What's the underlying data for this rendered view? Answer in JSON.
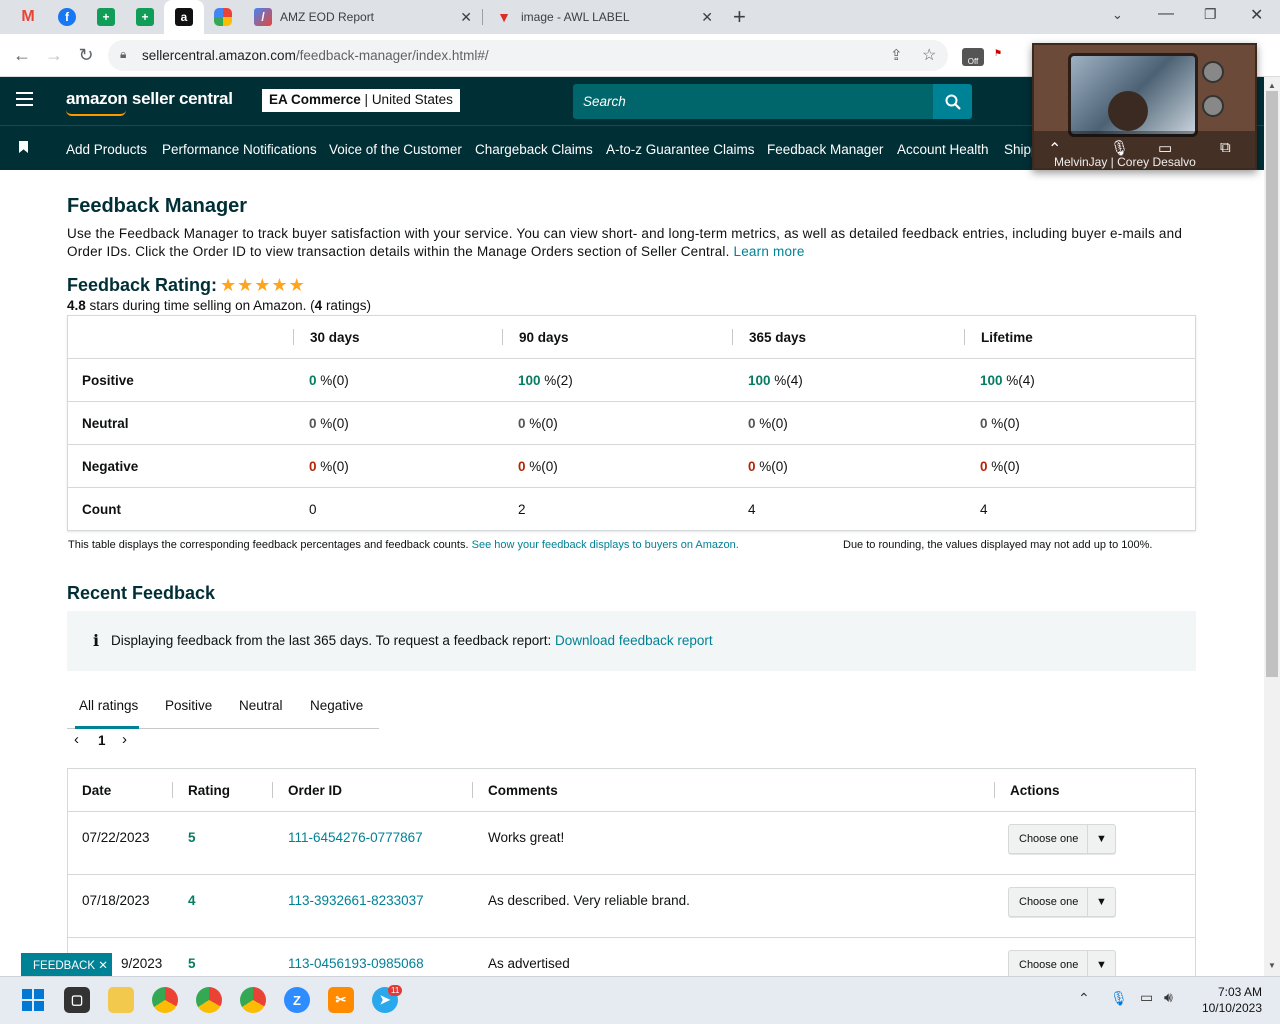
{
  "browser": {
    "tabs": [
      {
        "icon": "gmail-icon",
        "title": ""
      },
      {
        "icon": "facebook-icon",
        "title": ""
      },
      {
        "icon": "sheets-icon",
        "title": ""
      },
      {
        "icon": "sheets-icon",
        "title": ""
      },
      {
        "icon": "amazon-icon",
        "title": ""
      },
      {
        "icon": "apps-icon",
        "title": ""
      },
      {
        "icon": "report-icon",
        "title": "AMZ EOD Report"
      },
      {
        "icon": "label-icon",
        "title": "image - AWL LABEL"
      }
    ],
    "new_tab": "+",
    "url_host": "sellercentral.amazon.com",
    "url_path": "/feedback-manager/index.html#/"
  },
  "video_call": {
    "participants": "MelvinJay | Corey Desalvo"
  },
  "header": {
    "logo": "amazon seller central",
    "store_name": "EA Commerce",
    "store_region": "United States",
    "search_placeholder": "Search"
  },
  "nav": {
    "items": [
      "Add Products",
      "Performance Notifications",
      "Voice of the Customer",
      "Chargeback Claims",
      "A-to-z Guarantee Claims",
      "Feedback Manager",
      "Account Health",
      "Shipping"
    ]
  },
  "page": {
    "title": "Feedback Manager",
    "intro": "Use the Feedback Manager to track buyer satisfaction with your service. You can view short- and long-term metrics, as well as detailed feedback entries, including buyer e-mails and Order IDs. Click the Order ID to view transaction details within the Manage Orders section of Seller Central.",
    "learn_more": "Learn more",
    "rating_label": "Feedback Rating:",
    "rating_stars": 4.8,
    "rating_value": "4.8",
    "rating_text": "stars during time selling on Amazon. (",
    "rating_count": "4",
    "rating_suffix": "ratings)"
  },
  "summary_table": {
    "columns": [
      "30 days",
      "90 days",
      "365 days",
      "Lifetime"
    ],
    "rows": [
      {
        "label": "Positive",
        "values": [
          [
            "0",
            " %(0)"
          ],
          [
            "100",
            " %(2)"
          ],
          [
            "100",
            " %(4)"
          ],
          [
            "100",
            " %(4)"
          ]
        ]
      },
      {
        "label": "Neutral",
        "values": [
          [
            "0",
            " %(0)"
          ],
          [
            "0",
            " %(0)"
          ],
          [
            "0",
            " %(0)"
          ],
          [
            "0",
            " %(0)"
          ]
        ]
      },
      {
        "label": "Negative",
        "values": [
          [
            "0",
            " %(0)"
          ],
          [
            "0",
            " %(0)"
          ],
          [
            "0",
            " %(0)"
          ],
          [
            "0",
            " %(0)"
          ]
        ]
      },
      {
        "label": "Count",
        "values": [
          "0",
          "2",
          "4",
          "4"
        ]
      }
    ],
    "footnote": "This table displays the corresponding feedback percentages and feedback counts.",
    "footnote_link": "See how your feedback displays to buyers on Amazon.",
    "rounding_note": "Due to rounding, the values displayed may not add up to 100%."
  },
  "recent": {
    "title": "Recent Feedback",
    "info_text": "Displaying feedback from the last 365 days. To request a feedback report:",
    "info_link": "Download feedback report",
    "tabs": [
      "All ratings",
      "Positive",
      "Neutral",
      "Negative"
    ],
    "page": "1",
    "columns": [
      "Date",
      "Rating",
      "Order ID",
      "Comments",
      "Actions"
    ],
    "rows": [
      {
        "date": "07/22/2023",
        "rating": "5",
        "order": "111-6454276-0777867",
        "comment": "Works great!",
        "action": "Choose one"
      },
      {
        "date": "07/18/2023",
        "rating": "4",
        "order": "113-3932661-8233037",
        "comment": "As described. Very reliable brand.",
        "action": "Choose one"
      },
      {
        "date": "9/2023",
        "rating": "5",
        "order": "113-0456193-0985068",
        "comment": "As advertised",
        "action": "Choose one"
      }
    ]
  },
  "feedback_tab": "FEEDBACK",
  "taskbar": {
    "time": "7:03 AM",
    "date": "10/10/2023",
    "telegram_badge": "11"
  }
}
